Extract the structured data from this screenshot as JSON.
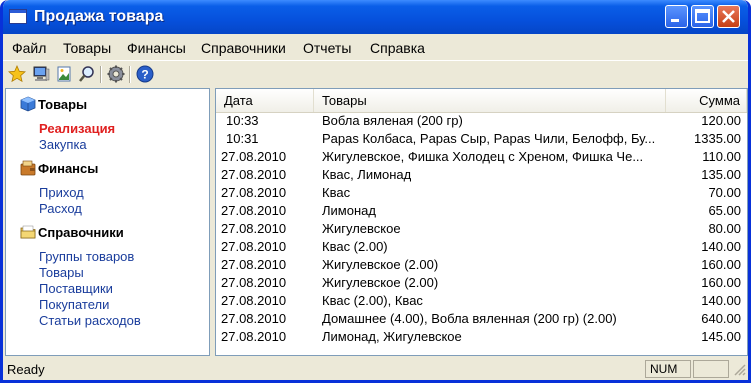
{
  "window": {
    "title": "Продажа товара"
  },
  "menu": [
    "Файл",
    "Товары",
    "Финансы",
    "Справочники",
    "Отчеты",
    "Справка"
  ],
  "toolbar": {
    "icons": [
      "star-icon",
      "monitor-icon",
      "image-icon",
      "search-icon",
      "gear-icon",
      "help-icon"
    ]
  },
  "sidebar": {
    "sections": [
      {
        "title": "Товары",
        "icon": "box-icon",
        "items": [
          "Реализация",
          "Закупка"
        ],
        "active": "Реализация"
      },
      {
        "title": "Финансы",
        "icon": "wallet-icon",
        "items": [
          "Приход",
          "Расход"
        ]
      },
      {
        "title": "Справочники",
        "icon": "folder-icon",
        "items": [
          "Группы товаров",
          "Товары",
          "Поставщики",
          "Покупатели",
          "Статьи расходов"
        ]
      }
    ]
  },
  "table": {
    "columns": [
      "Дата",
      "Товары",
      "Сумма"
    ],
    "rows": [
      [
        "10:33",
        "Вобла вяленая (200 гр)",
        "120.00"
      ],
      [
        "10:31",
        "Papas Колбаса, Papas Сыр, Papas Чили, Белофф, Бу...",
        "1335.00"
      ],
      [
        "27.08.2010",
        "Жигулевское, Фишка Холодец с Хреном, Фишка Че...",
        "110.00"
      ],
      [
        "27.08.2010",
        "Квас, Лимонад",
        "135.00"
      ],
      [
        "27.08.2010",
        "Квас",
        "70.00"
      ],
      [
        "27.08.2010",
        "Лимонад",
        "65.00"
      ],
      [
        "27.08.2010",
        "Жигулевское",
        "80.00"
      ],
      [
        "27.08.2010",
        "Квас (2.00)",
        "140.00"
      ],
      [
        "27.08.2010",
        "Жигулевское (2.00)",
        "160.00"
      ],
      [
        "27.08.2010",
        "Жигулевское (2.00)",
        "160.00"
      ],
      [
        "27.08.2010",
        "Квас (2.00), Квас",
        "140.00"
      ],
      [
        "27.08.2010",
        "Домашнее (4.00), Вобла вяленная (200 гр) (2.00)",
        "640.00"
      ],
      [
        "27.08.2010",
        "Лимонад, Жигулевское",
        "145.00"
      ]
    ]
  },
  "status": {
    "text": "Ready",
    "num": "NUM"
  }
}
